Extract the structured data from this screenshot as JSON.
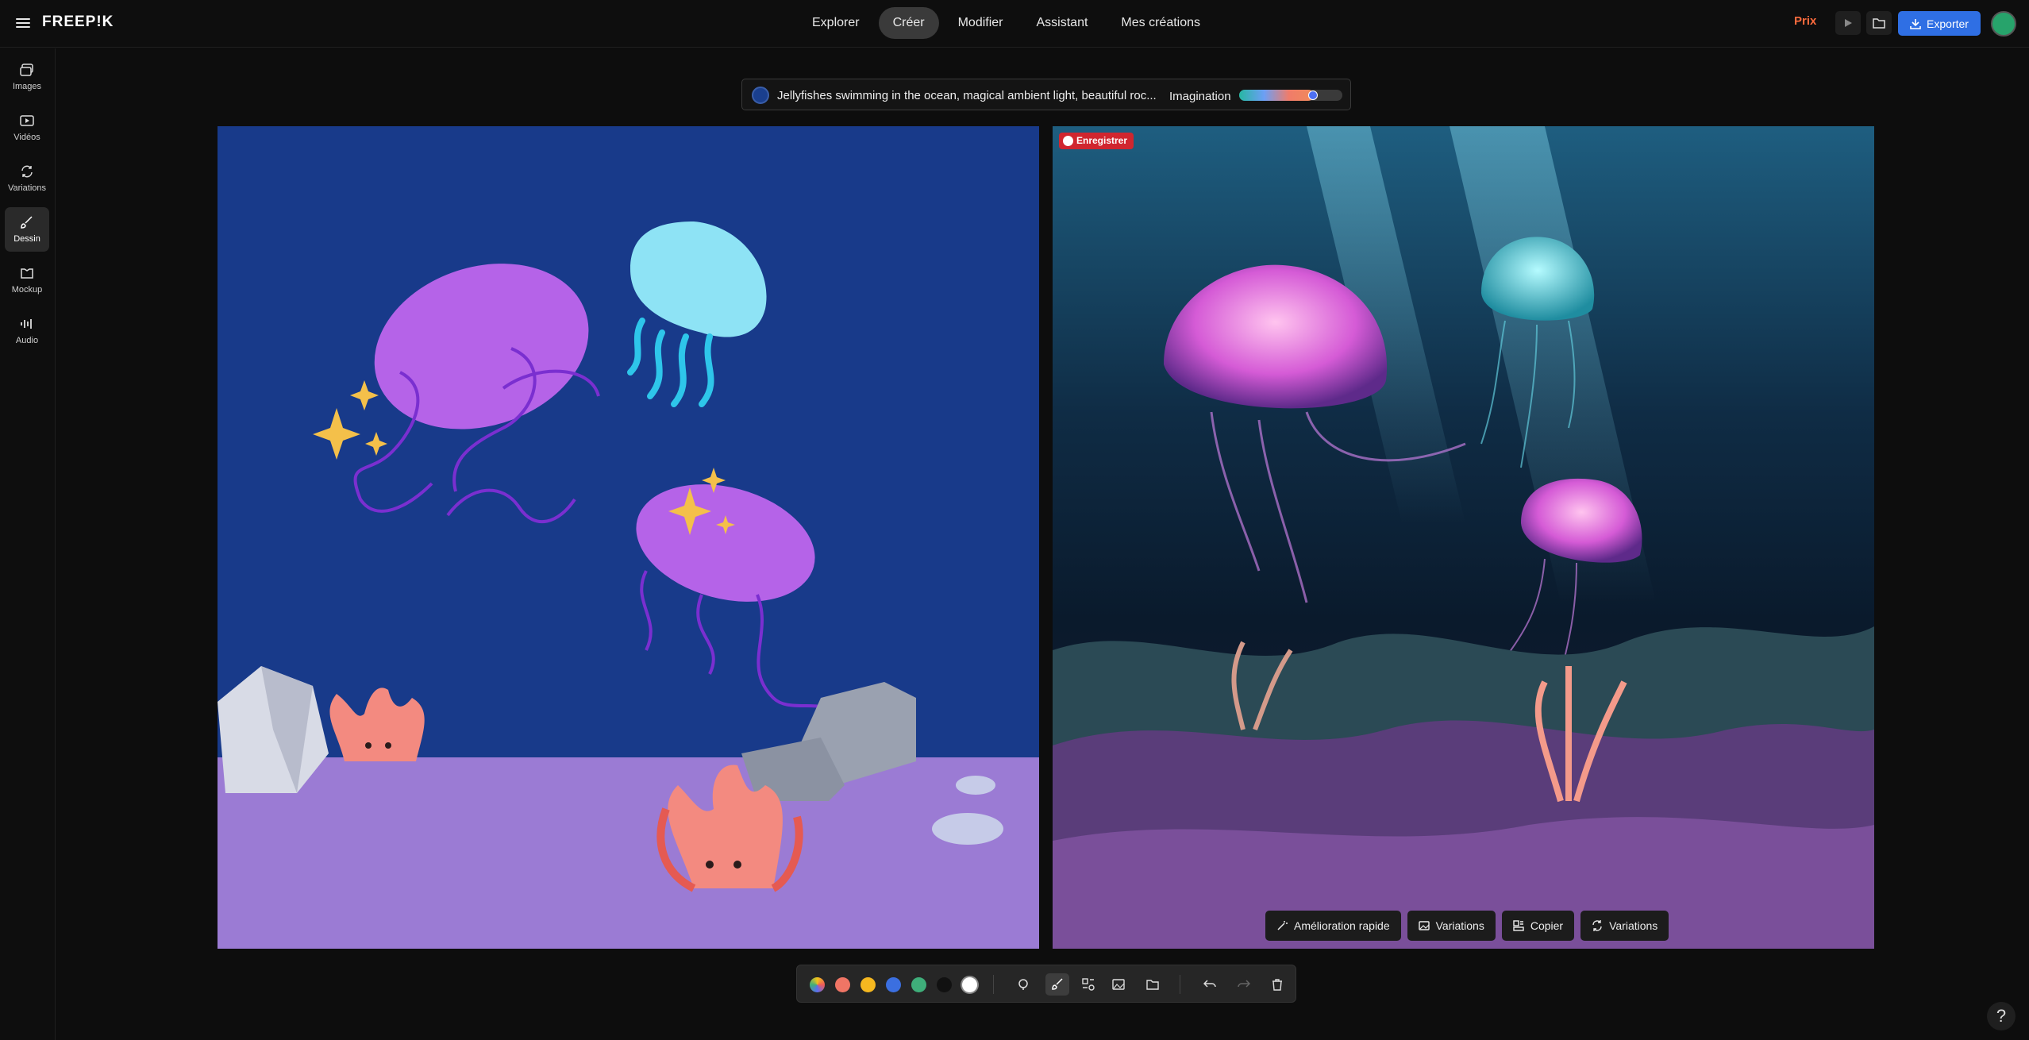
{
  "app": {
    "logo": "FREEP!K"
  },
  "nav": {
    "tabs": [
      {
        "label": "Explorer"
      },
      {
        "label": "Créer"
      },
      {
        "label": "Modifier"
      },
      {
        "label": "Assistant"
      },
      {
        "label": "Mes créations"
      }
    ],
    "active": "Créer"
  },
  "header": {
    "prix": "Prix",
    "export_label": "Exporter"
  },
  "sidebar": {
    "items": [
      {
        "label": "Images",
        "icon": "images-icon"
      },
      {
        "label": "Vidéos",
        "icon": "video-icon"
      },
      {
        "label": "Variations",
        "icon": "variations-icon"
      },
      {
        "label": "Dessin",
        "icon": "brush-icon"
      },
      {
        "label": "Mockup",
        "icon": "mockup-icon"
      },
      {
        "label": "Audio",
        "icon": "audio-icon"
      }
    ],
    "active": "Dessin"
  },
  "prompt": {
    "text": "Jellyfishes swimming in the ocean, magical ambient light, beautiful roc...",
    "imagination_label": "Imagination",
    "imagination_level": 0.72,
    "color": "#1a3f8e"
  },
  "canvas": {
    "left_bg": "#183a8a",
    "floor_color": "#9b7bd4"
  },
  "result": {
    "badge": "Enregistrer",
    "actions": [
      {
        "label": "Amélioration rapide",
        "icon": "magic-wand-icon"
      },
      {
        "label": "Variations",
        "icon": "image-icon"
      },
      {
        "label": "Copier",
        "icon": "copy-icon"
      },
      {
        "label": "Variations",
        "icon": "refresh-icon"
      }
    ]
  },
  "toolbar": {
    "colors": [
      "#f2c418",
      "#f07565",
      "#f5b820",
      "#3b6fe0",
      "#3fae7a",
      "#111111",
      "#ffffff"
    ],
    "tools": [
      "pen-icon",
      "brush-icon",
      "shapes-icon",
      "image-icon",
      "folder-icon",
      "undo-icon",
      "redo-icon",
      "trash-icon"
    ]
  },
  "help": {
    "label": "?"
  }
}
